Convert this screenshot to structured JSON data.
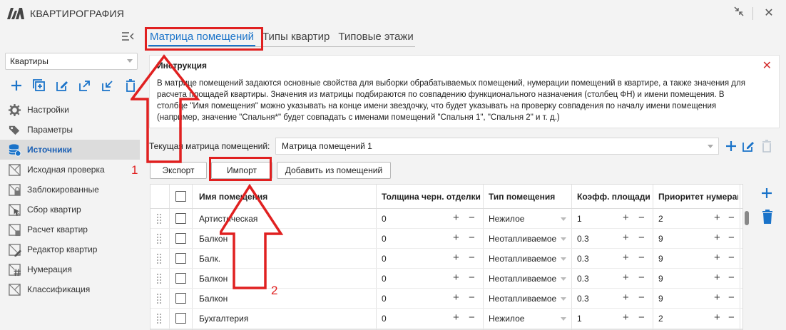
{
  "window": {
    "title": "КВАРТИРОГРАФИЯ"
  },
  "sidebar": {
    "selector_value": "Квартиры",
    "nav_items": [
      {
        "label": "Настройки",
        "icon": "gear-icon"
      },
      {
        "label": "Параметры",
        "icon": "tags-icon"
      },
      {
        "label": "Источники",
        "icon": "database-icon"
      },
      {
        "label": "Исходная проверка",
        "icon": "check-frame-icon"
      },
      {
        "label": "Заблокированные",
        "icon": "locked-frame-icon"
      },
      {
        "label": "Сбор квартир",
        "icon": "cursor-frame-icon"
      },
      {
        "label": "Расчет квартир",
        "icon": "calc-frame-icon"
      },
      {
        "label": "Редактор квартир",
        "icon": "edit-frame-icon"
      },
      {
        "label": "Нумерация",
        "icon": "hash-frame-icon"
      },
      {
        "label": "Классификация",
        "icon": "classify-frame-icon"
      }
    ]
  },
  "tabs": [
    {
      "label": "Матрица помещений"
    },
    {
      "label": "Типы квартир"
    },
    {
      "label": "Типовые этажи"
    }
  ],
  "info": {
    "title": "Инструкция",
    "lines": [
      "В матрице помещений задаются основные свойства для выборки обрабатываемых помещений, нумерации помещений в квартире, а также значения для",
      "расчета площадей квартиры. Значения из матрицы подбираются по совпадению функционального назначения (столбец ФН) и имени помещения. В",
      "столбце \"Имя помещения\" можно указывать на конце имени звездочку, что будет указывать на проверку совпадения по началу имени помещения",
      "(например, значение \"Спальня*\" будет совпадать с именами помещений \"Спальня 1\", \"Спальня 2\" и т. д.)"
    ]
  },
  "matrix": {
    "label": "Текущая матрица помещений:",
    "value": "Матрица помещений 1"
  },
  "buttons": {
    "export": "Экспорт",
    "import": "Импорт",
    "add_from_rooms": "Добавить из помещений"
  },
  "grid": {
    "headers": [
      "Имя помещения",
      "Толщина черн. отделки",
      "Тип помещения",
      "Коэфф. площади",
      "Приоритет нумерац"
    ],
    "rows": [
      {
        "name": "Артистическая",
        "thickness": "0",
        "type": "Нежилое",
        "coef": "1",
        "priority": "2"
      },
      {
        "name": "Балкон",
        "thickness": "0",
        "type": "Неотапливаемое",
        "coef": "0.3",
        "priority": "9"
      },
      {
        "name": "Балк.",
        "thickness": "0",
        "type": "Неотапливаемое",
        "coef": "0.3",
        "priority": "9"
      },
      {
        "name": "Балкон",
        "thickness": "0",
        "type": "Неотапливаемое",
        "coef": "0.3",
        "priority": "9"
      },
      {
        "name": "Балкон",
        "thickness": "0",
        "type": "Неотапливаемое",
        "coef": "0.3",
        "priority": "9"
      },
      {
        "name": "Бухгалтерия",
        "thickness": "0",
        "type": "Нежилое",
        "coef": "1",
        "priority": "2"
      }
    ],
    "plus": "+",
    "minus": "−"
  },
  "annotations": {
    "label_1": "1",
    "label_2": "2"
  },
  "colors": {
    "accent": "#1a73c9",
    "annotation": "#e02020",
    "close": "#d32f2f"
  }
}
